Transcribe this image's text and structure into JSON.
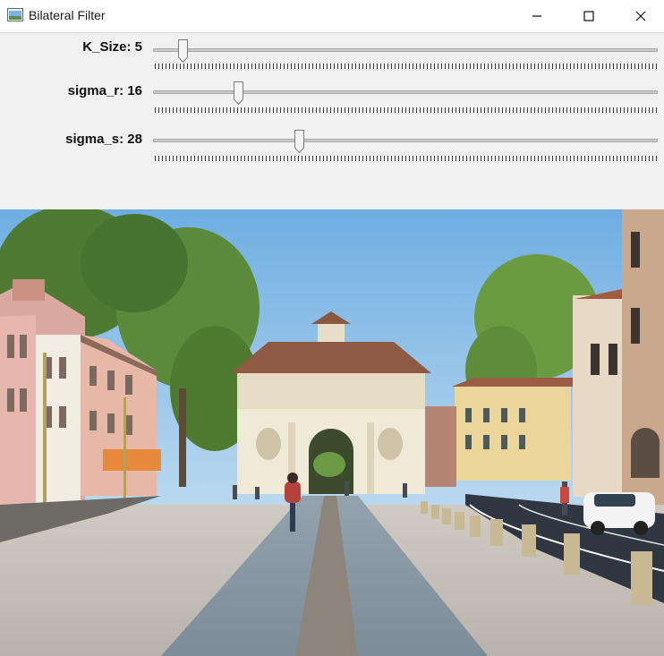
{
  "window": {
    "title": "Bilateral Filter",
    "controls": {
      "minimize": "minimize-icon",
      "maximize": "maximize-icon",
      "close": "close-icon"
    }
  },
  "trackbars": [
    {
      "name": "K_Size",
      "label": "K_Size: 5",
      "value": 5,
      "fraction": 0.06
    },
    {
      "name": "sigma_r",
      "label": "sigma_r: 16",
      "value": 16,
      "fraction": 0.17
    },
    {
      "name": "sigma_s",
      "label": "sigma_s: 28",
      "value": 28,
      "fraction": 0.29
    }
  ],
  "colors": {
    "sky": "#78b4e4",
    "track": "#c9c9c9",
    "panel": "#f0f0f0"
  }
}
